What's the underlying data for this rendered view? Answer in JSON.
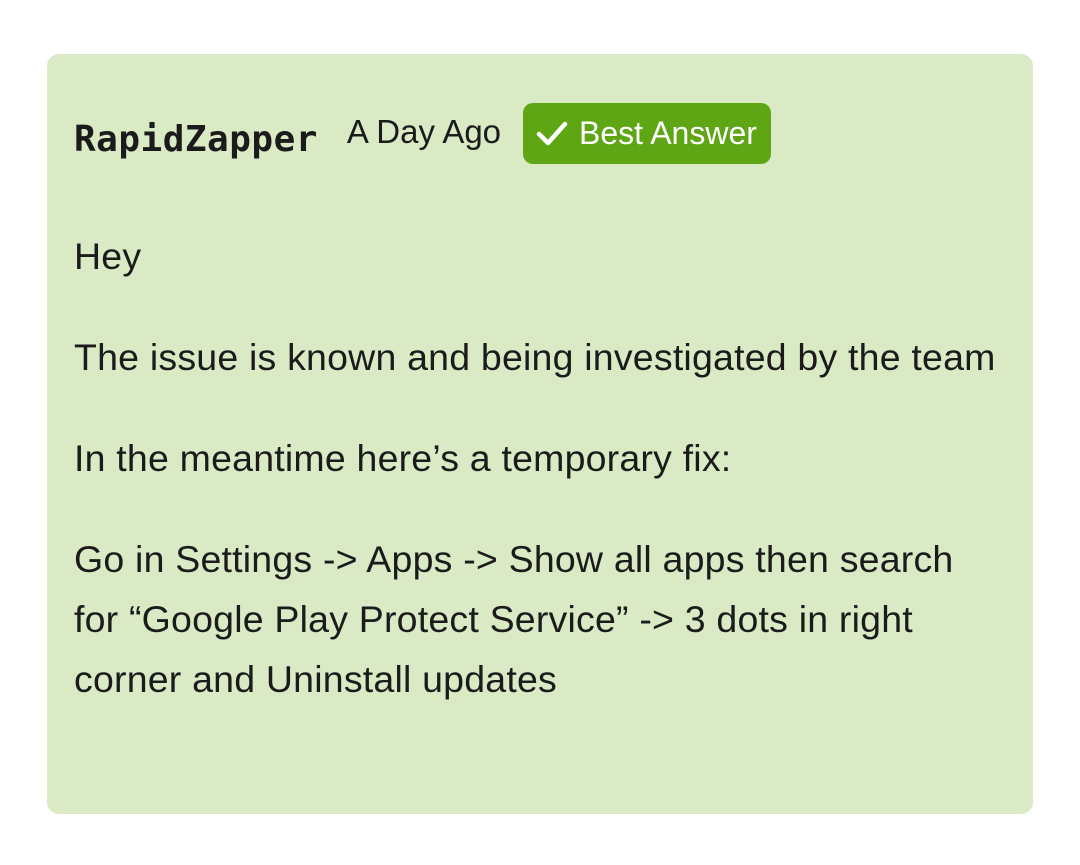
{
  "answer": {
    "username": "RapidZapper",
    "timestamp": "A Day Ago",
    "badge": {
      "icon": "checkmark-icon",
      "label": "Best Answer",
      "color": "#5ea613"
    },
    "paragraphs": [
      "Hey",
      "The issue is known and being investigated by the team",
      "In the meantime here’s a temporary fix:",
      "Go in Settings -> Apps -> Show all apps then search for “Google Play Protect Service” -> 3 dots in right corner and Uninstall updates"
    ],
    "card_color": "#d9eac5"
  }
}
